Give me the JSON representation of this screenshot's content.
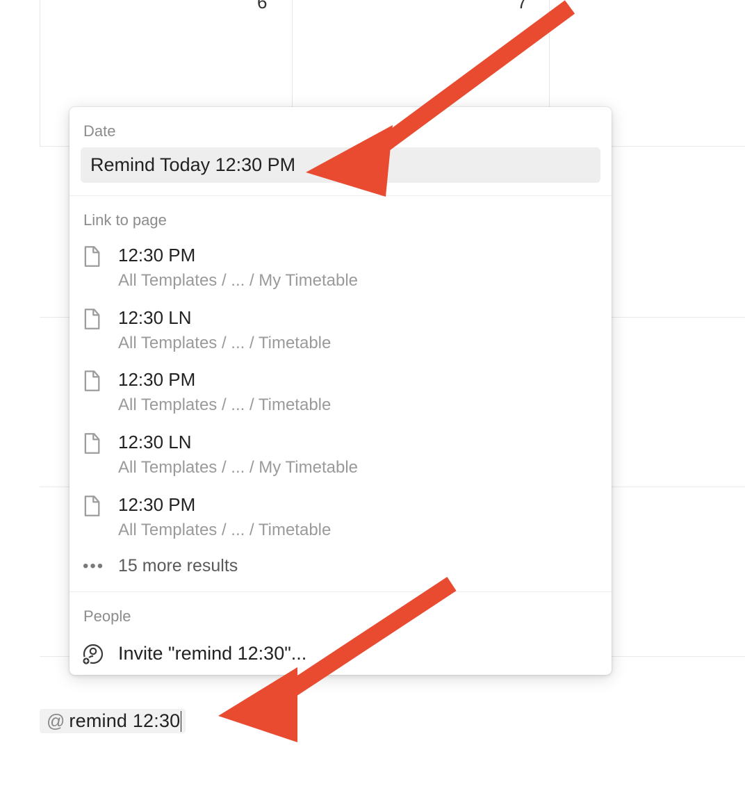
{
  "calendar": {
    "date_left": "6",
    "date_right": "7"
  },
  "popup": {
    "sections": {
      "date": {
        "label": "Date",
        "option": "Remind Today 12:30 PM"
      },
      "linkToPage": {
        "label": "Link to page",
        "items": [
          {
            "title": "12:30 PM",
            "path": "All Templates / ... / My Timetable"
          },
          {
            "title": "12:30 LN",
            "path": "All Templates / ... / Timetable"
          },
          {
            "title": "12:30 PM",
            "path": "All Templates / ... / Timetable"
          },
          {
            "title": "12:30 LN",
            "path": "All Templates / ... / My Timetable"
          },
          {
            "title": "12:30 PM",
            "path": "All Templates / ... / Timetable"
          }
        ],
        "moreResults": "15 more results"
      },
      "people": {
        "label": "People",
        "invite": "Invite \"remind 12:30\"..."
      }
    }
  },
  "input": {
    "prefix": "@",
    "value": "remind 12:30"
  },
  "colors": {
    "arrow": "#e84b30"
  }
}
